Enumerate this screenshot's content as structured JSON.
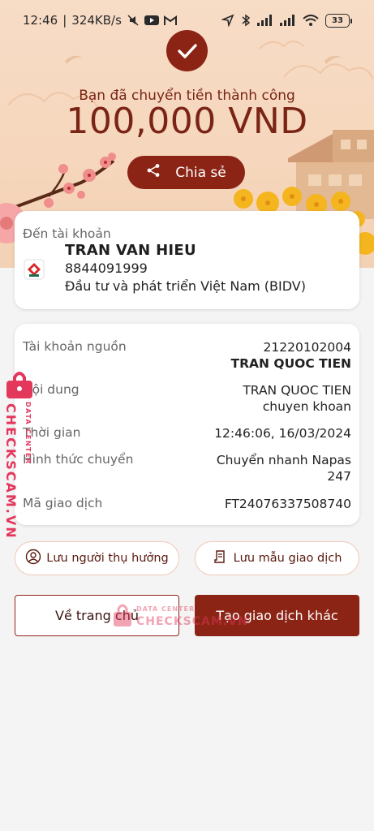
{
  "status_bar": {
    "time": "12:46",
    "speed": "324KB/s",
    "battery": "33"
  },
  "header": {
    "subtitle": "Bạn đã chuyển tiền thành công",
    "amount": "100,000 VND",
    "share_label": "Chia sẻ"
  },
  "recipient": {
    "label": "Đến tài khoản",
    "name": "TRAN VAN HIEU",
    "account": "8844091999",
    "bank": "Đầu tư và phát triển Việt Nam (BIDV)"
  },
  "details": {
    "source_label": "Tài khoản nguồn",
    "source_account": "21220102004",
    "source_name": "TRAN QUOC TIEN",
    "content_label": "Nội dung",
    "content_line1": "TRAN QUOC TIEN",
    "content_line2": "chuyen khoan",
    "time_label": "Thời gian",
    "time_value": "12:46:06, 16/03/2024",
    "method_label": "Hình thức chuyển",
    "method_line1": "Chuyển nhanh Napas",
    "method_line2": "247",
    "txn_label": "Mã giao dịch",
    "txn_value": "FT24076337508740"
  },
  "actions": {
    "save_beneficiary": "Lưu người thụ hưởng",
    "save_template": "Lưu mẫu giao dịch",
    "home": "Về trang chủ",
    "new_transaction": "Tạo giao dịch khác"
  },
  "watermark": {
    "brand": "CHECKSCAM.VN",
    "sub": "DATA CENTER"
  },
  "colors": {
    "primary": "#8c2416",
    "hero_bg": "#f6d7bd",
    "watermark": "#e3375c"
  }
}
